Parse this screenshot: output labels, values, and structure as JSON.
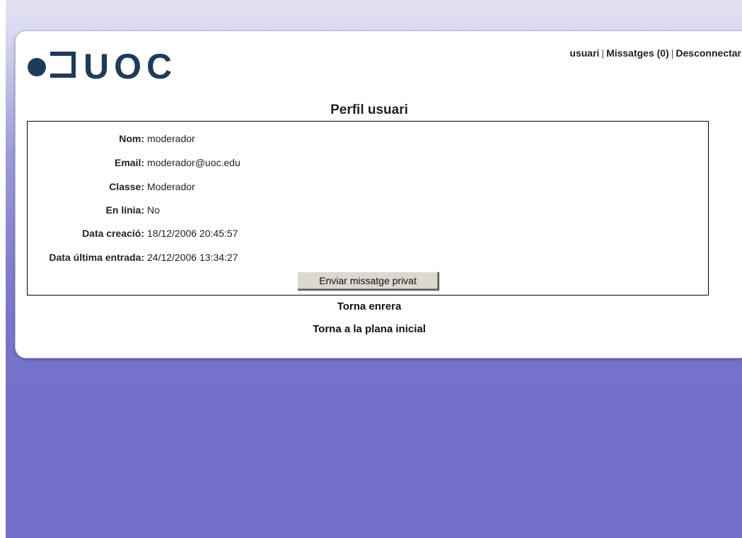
{
  "brand": {
    "logo_text": "UOC",
    "logo_color": "#1f3b5c"
  },
  "topnav": {
    "user": "usuari",
    "separator": "|",
    "messages": "Missatges (0)",
    "logout": "Desconnectar"
  },
  "page": {
    "title": "Perfil usuari"
  },
  "profile": {
    "fields": [
      {
        "label": "Nom:",
        "value": "moderador"
      },
      {
        "label": "Email:",
        "value": "moderador@uoc.edu"
      },
      {
        "label": "Classe:",
        "value": "Moderador"
      },
      {
        "label": "En línia:",
        "value": "No"
      },
      {
        "label": "Data creació:",
        "value": "18/12/2006 20:45:57"
      },
      {
        "label": "Data última entrada:",
        "value": "24/12/2006 13:34:27"
      }
    ],
    "send_button": "Enviar missatge privat"
  },
  "links": {
    "back": "Torna enrera",
    "home": "Torna a la plana inicial"
  },
  "colors": {
    "background": "#7270c8",
    "card": "#ffffff",
    "text": "#222222"
  }
}
